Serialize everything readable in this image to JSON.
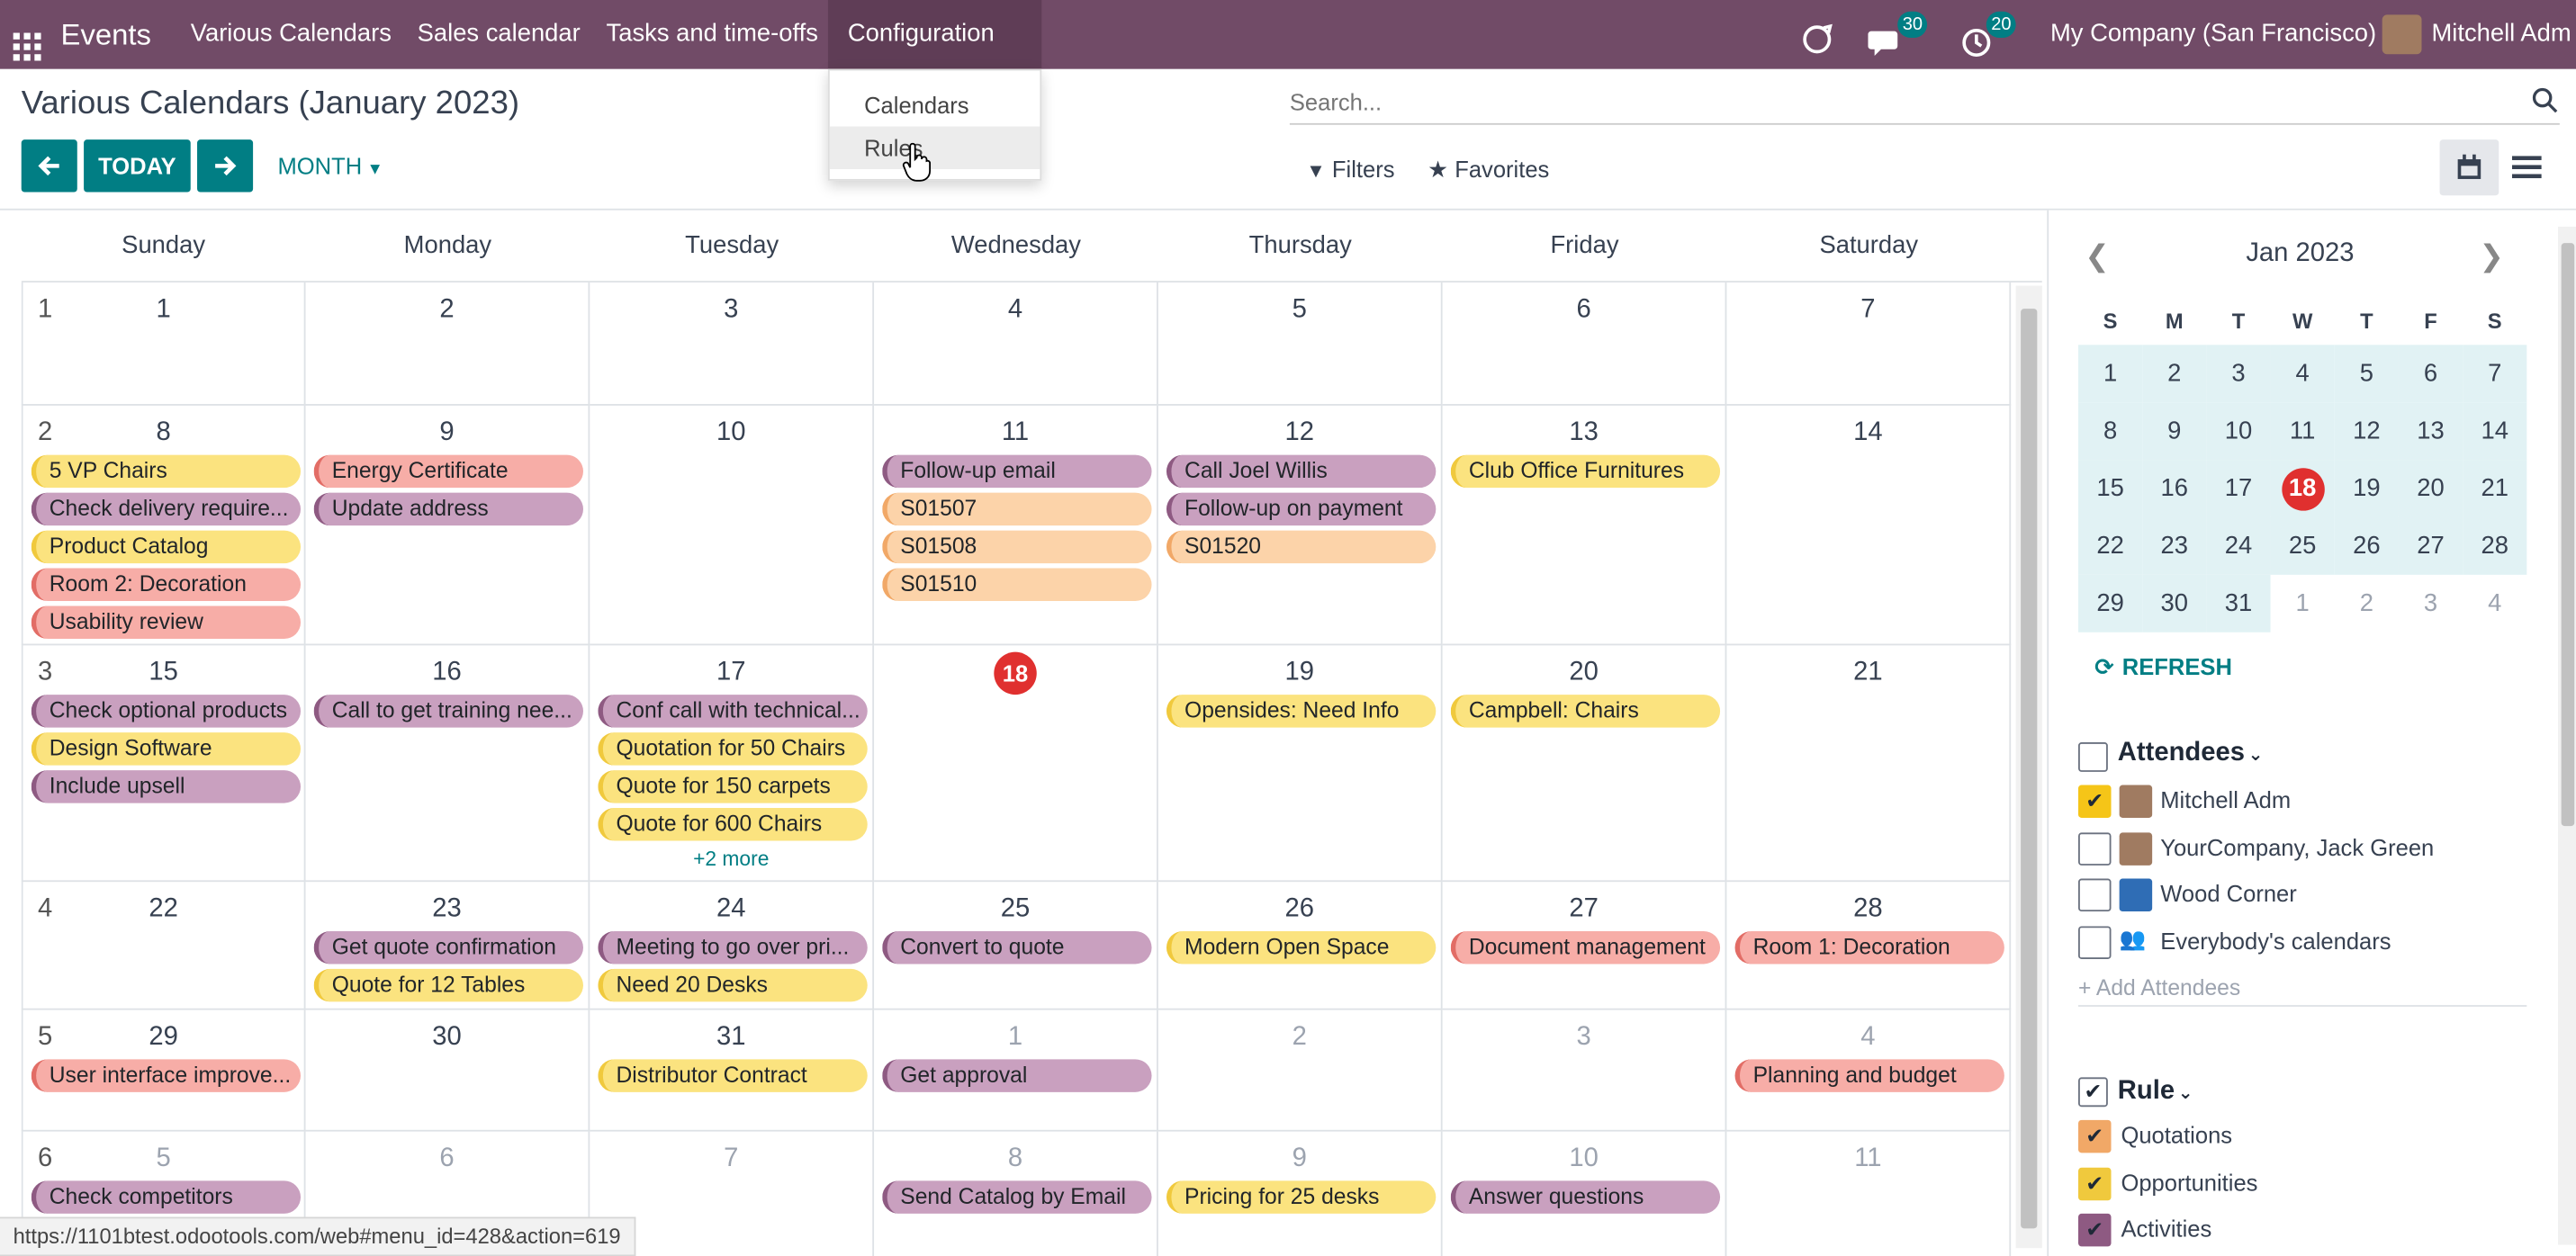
{
  "navbar": {
    "app_name": "Events",
    "menu": [
      "Various Calendars",
      "Sales calendar",
      "Tasks and time-offs",
      "Configuration"
    ],
    "messages_count": "30",
    "activities_count": "20",
    "company": "My Company (San Francisco)",
    "user": "Mitchell Adm"
  },
  "dropdown": {
    "items": [
      "Calendars",
      "Rules"
    ]
  },
  "control": {
    "title": "Various Calendars (January 2023)",
    "today": "TODAY",
    "scale": "MONTH",
    "search_placeholder": "Search...",
    "filters": "Filters",
    "favorites": "Favorites"
  },
  "calendar": {
    "weekdays": [
      "Sunday",
      "Monday",
      "Tuesday",
      "Wednesday",
      "Thursday",
      "Friday",
      "Saturday"
    ],
    "today": 18,
    "weeks": [
      {
        "num": "1",
        "days": [
          {
            "d": "1"
          },
          {
            "d": "2"
          },
          {
            "d": "3"
          },
          {
            "d": "4"
          },
          {
            "d": "5"
          },
          {
            "d": "6"
          },
          {
            "d": "7"
          }
        ]
      },
      {
        "num": "2",
        "days": [
          {
            "d": "8",
            "events": [
              {
                "t": "5 VP Chairs",
                "c": "yellow"
              },
              {
                "t": "Check delivery require...",
                "c": "purple"
              },
              {
                "t": "Product Catalog",
                "c": "yellow"
              },
              {
                "t": "Room 2: Decoration",
                "c": "pink"
              },
              {
                "t": "Usability review",
                "c": "pink"
              }
            ]
          },
          {
            "d": "9",
            "events": [
              {
                "t": "Energy Certificate",
                "c": "pink"
              },
              {
                "t": "Update address",
                "c": "purple"
              }
            ]
          },
          {
            "d": "10"
          },
          {
            "d": "11",
            "events": [
              {
                "t": "Follow-up email",
                "c": "purple"
              },
              {
                "t": "S01507",
                "c": "peach"
              },
              {
                "t": "S01508",
                "c": "peach"
              },
              {
                "t": "S01510",
                "c": "peach"
              }
            ]
          },
          {
            "d": "12",
            "events": [
              {
                "t": "Call Joel Willis",
                "c": "purple"
              },
              {
                "t": "Follow-up on payment",
                "c": "purple"
              },
              {
                "t": "S01520",
                "c": "peach"
              }
            ]
          },
          {
            "d": "13",
            "events": [
              {
                "t": "Club Office Furnitures",
                "c": "yellow"
              }
            ]
          },
          {
            "d": "14"
          }
        ]
      },
      {
        "num": "3",
        "days": [
          {
            "d": "15",
            "events": [
              {
                "t": "Check optional products",
                "c": "purple"
              },
              {
                "t": "Design Software",
                "c": "yellow"
              },
              {
                "t": "Include upsell",
                "c": "purple"
              }
            ]
          },
          {
            "d": "16",
            "events": [
              {
                "t": "Call to get training nee...",
                "c": "purple"
              }
            ]
          },
          {
            "d": "17",
            "events": [
              {
                "t": "Conf call with technical...",
                "c": "purple"
              },
              {
                "t": "Quotation for 50 Chairs",
                "c": "yellow"
              },
              {
                "t": "Quote for 150 carpets",
                "c": "yellow"
              },
              {
                "t": "Quote for 600 Chairs",
                "c": "yellow"
              }
            ],
            "more": "+2 more"
          },
          {
            "d": "18"
          },
          {
            "d": "19",
            "events": [
              {
                "t": "Opensides: Need Info",
                "c": "yellow"
              }
            ]
          },
          {
            "d": "20",
            "events": [
              {
                "t": "Campbell: Chairs",
                "c": "yellow"
              }
            ]
          },
          {
            "d": "21"
          }
        ]
      },
      {
        "num": "4",
        "days": [
          {
            "d": "22"
          },
          {
            "d": "23",
            "events": [
              {
                "t": "Get quote confirmation",
                "c": "purple"
              },
              {
                "t": "Quote for 12 Tables",
                "c": "yellow"
              }
            ]
          },
          {
            "d": "24",
            "events": [
              {
                "t": "Meeting to go over pri...",
                "c": "purple"
              },
              {
                "t": "Need 20 Desks",
                "c": "yellow"
              }
            ]
          },
          {
            "d": "25",
            "events": [
              {
                "t": "Convert to quote",
                "c": "purple"
              }
            ]
          },
          {
            "d": "26",
            "events": [
              {
                "t": "Modern Open Space",
                "c": "yellow"
              }
            ]
          },
          {
            "d": "27",
            "events": [
              {
                "t": "Document management",
                "c": "pink"
              }
            ]
          },
          {
            "d": "28",
            "events": [
              {
                "t": "Room 1: Decoration",
                "c": "pink"
              }
            ]
          }
        ]
      },
      {
        "num": "5",
        "days": [
          {
            "d": "29",
            "events": [
              {
                "t": "User interface improve...",
                "c": "pink"
              }
            ]
          },
          {
            "d": "30"
          },
          {
            "d": "31",
            "events": [
              {
                "t": "Distributor Contract",
                "c": "yellow"
              }
            ]
          },
          {
            "d": "1",
            "out": true,
            "events": [
              {
                "t": "Get approval",
                "c": "purple"
              }
            ]
          },
          {
            "d": "2",
            "out": true
          },
          {
            "d": "3",
            "out": true
          },
          {
            "d": "4",
            "out": true,
            "events": [
              {
                "t": "Planning and budget",
                "c": "pink"
              }
            ]
          }
        ]
      },
      {
        "num": "6",
        "days": [
          {
            "d": "5",
            "out": true,
            "events": [
              {
                "t": "Check competitors",
                "c": "purple"
              }
            ]
          },
          {
            "d": "6",
            "out": true
          },
          {
            "d": "7",
            "out": true
          },
          {
            "d": "8",
            "out": true,
            "events": [
              {
                "t": "Send Catalog by Email",
                "c": "purple"
              }
            ]
          },
          {
            "d": "9",
            "out": true,
            "events": [
              {
                "t": "Pricing for 25 desks",
                "c": "yellow"
              }
            ]
          },
          {
            "d": "10",
            "out": true,
            "events": [
              {
                "t": "Answer questions",
                "c": "purple"
              }
            ]
          },
          {
            "d": "11",
            "out": true
          }
        ]
      }
    ]
  },
  "mini_calendar": {
    "month": "Jan 2023",
    "weekday_initials": [
      "S",
      "M",
      "T",
      "W",
      "T",
      "F",
      "S"
    ],
    "rows": [
      [
        "1",
        "2",
        "3",
        "4",
        "5",
        "6",
        "7"
      ],
      [
        "8",
        "9",
        "10",
        "11",
        "12",
        "13",
        "14"
      ],
      [
        "15",
        "16",
        "17",
        "18",
        "19",
        "20",
        "21"
      ],
      [
        "22",
        "23",
        "24",
        "25",
        "26",
        "27",
        "28"
      ],
      [
        "29",
        "30",
        "31",
        "1",
        "2",
        "3",
        "4"
      ]
    ],
    "refresh": "REFRESH"
  },
  "attendees": {
    "title": "Attendees",
    "items": [
      {
        "label": "Mitchell Adm",
        "checked": true,
        "color": "#f5c518"
      },
      {
        "label": "YourCompany, Jack Green",
        "checked": false
      },
      {
        "label": "Wood Corner",
        "checked": false
      },
      {
        "label": "Everybody's calendars",
        "checked": false
      }
    ],
    "add": "+ Add Attendees"
  },
  "rules": {
    "title": "Rule",
    "items": [
      {
        "label": "Quotations",
        "checked": true,
        "color": "#f1a867"
      },
      {
        "label": "Opportunities",
        "checked": true,
        "color": "#f0c93d"
      },
      {
        "label": "Activities",
        "checked": true,
        "color": "#8e5a82"
      }
    ]
  },
  "status_url": "https://1101btest.odootools.com/web#menu_id=428&action=619",
  "colors": {
    "navbar": "#714b67",
    "accent": "#017e84",
    "today": "#e0302f"
  }
}
